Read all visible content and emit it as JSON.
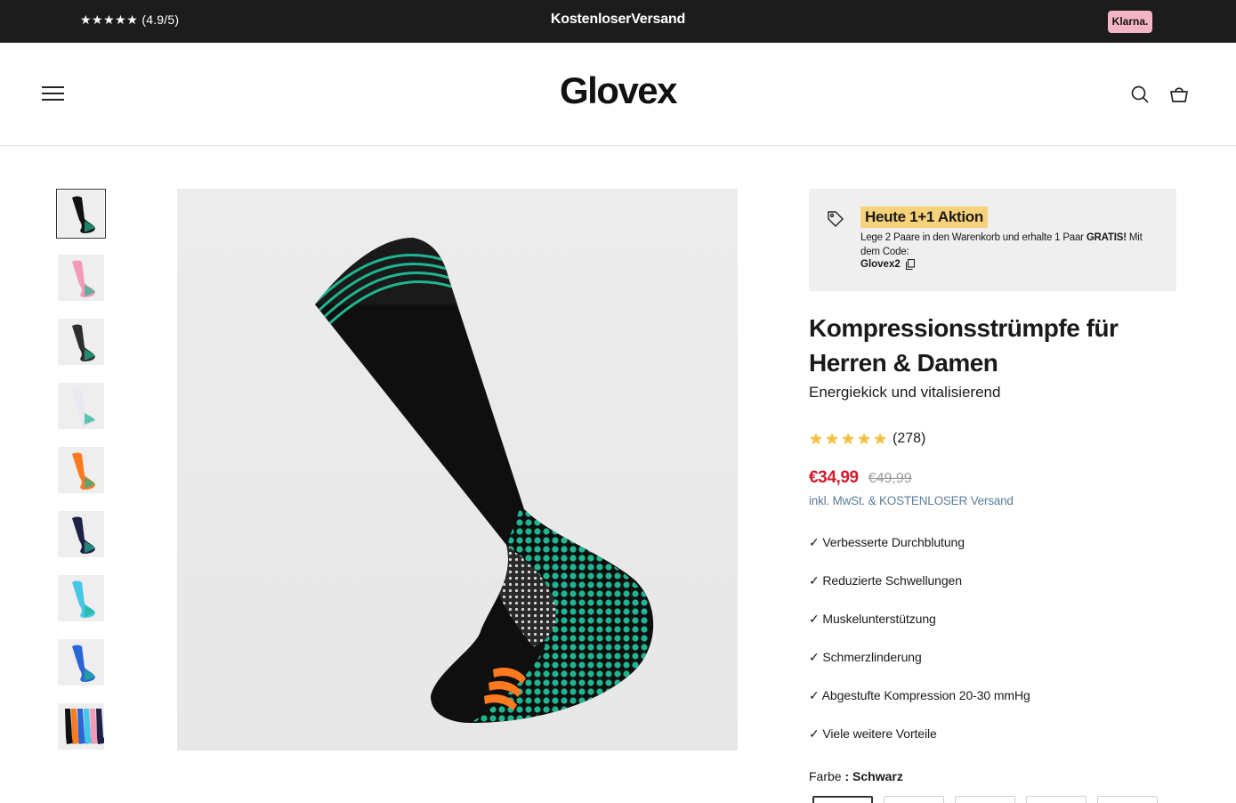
{
  "announcement": {
    "rating_stars": "★★★★★",
    "rating_text": "(4.9/5)",
    "shipping": "KostenloserVersand",
    "klarna_label": "Klarna."
  },
  "header": {
    "logo": "Glovex",
    "icons": [
      "hamburger-menu-icon",
      "search-icon",
      "cart-icon"
    ]
  },
  "gallery": {
    "thumbnails": [
      {
        "name": "black",
        "color": "#111111"
      },
      {
        "name": "pink",
        "color": "#f29ab7"
      },
      {
        "name": "lifestyle",
        "color": "#2e2e2e"
      },
      {
        "name": "white",
        "color": "#e8e8ef"
      },
      {
        "name": "orange",
        "color": "#ff7a1f"
      },
      {
        "name": "navy",
        "color": "#1f2244"
      },
      {
        "name": "light-blue",
        "color": "#46c7e6"
      },
      {
        "name": "blue",
        "color": "#2a66d6"
      },
      {
        "name": "all-colors",
        "color": "#777777"
      }
    ],
    "active_index": 0
  },
  "promo": {
    "badge": "Heute 1+1 Aktion",
    "text_before": "Lege 2 Paare in den Warenkorb und erhalte 1 Paar ",
    "text_bold": "GRATIS!",
    "text_after": " Mit dem Code:",
    "code": "Glovex2"
  },
  "product": {
    "title": "Kompressionsstrümpfe für Herren & Damen",
    "subtitle": "Energiekick und vitalisierend",
    "rating": 5,
    "review_count": "(278)",
    "price": "€34,99",
    "compare_price": "€49,99",
    "tax_note": "inkl. MwSt. & KOSTENLOSER Versand",
    "benefits": [
      "✓ Verbesserte Durchblutung",
      "✓ Reduzierte Schwellungen",
      "✓ Muskelunterstützung",
      "✓ Schmerzlinderung",
      "✓ Abgestufte Kompression 20-30 mmHg",
      "✓ Viele weitere Vorteile"
    ],
    "color_label": "Farbe",
    "color_value": ": Schwarz"
  },
  "colors": {
    "accent_sale": "#d21c2c",
    "promo_badge": "#f7d27a",
    "teal_pattern": "#1fb591",
    "star": "#f5c044"
  }
}
